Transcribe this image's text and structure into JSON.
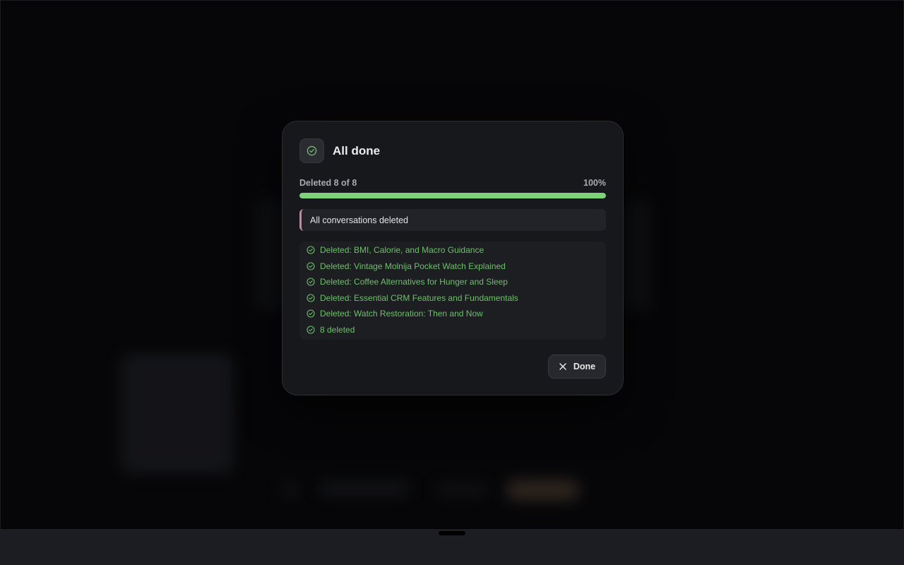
{
  "dialog": {
    "title": "All done",
    "progress": {
      "label": "Deleted 8 of 8",
      "percent_label": "100%",
      "fraction": 1.0,
      "color": "#7ed37a"
    },
    "status_message": "All conversations deleted",
    "log": [
      "Deleted: BMI, Calorie, and Macro Guidance",
      "Deleted: Vintage Molnija Pocket Watch Explained",
      "Deleted: Coffee Alternatives for Hunger and Sleep",
      "Deleted: Essential CRM Features and Fundamentals",
      "Deleted: Watch Restoration: Then and Now",
      "8 deleted"
    ],
    "done_label": "Done",
    "icons": {
      "status": "check-circle-icon",
      "log_item": "check-circle-icon",
      "done": "close-icon"
    }
  }
}
